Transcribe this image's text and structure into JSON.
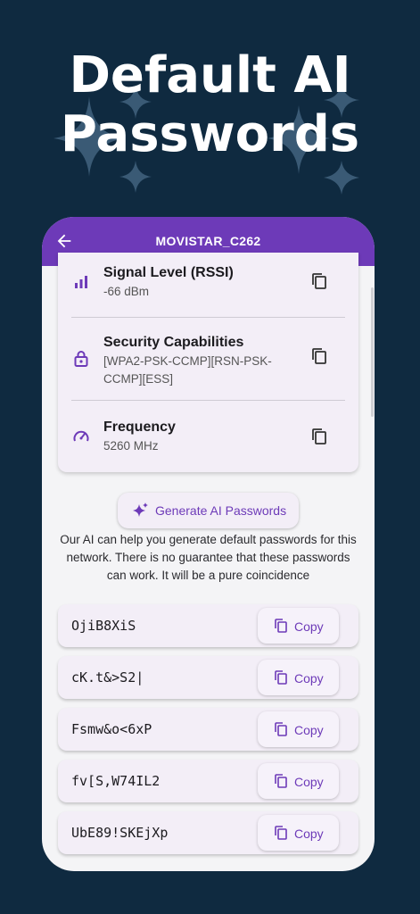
{
  "headline": {
    "line1": "Default AI",
    "line2": "Passwords"
  },
  "colors": {
    "background": "#0f2a40",
    "accent": "#6d3ab8",
    "surface": "#f3eef7",
    "sparkle": "#3a5a75"
  },
  "appbar": {
    "title": "MOVISTAR_C262",
    "back_icon": "arrow-left-icon"
  },
  "network_info": [
    {
      "label": "Signal Level (RSSI)",
      "value": "-66 dBm",
      "icon": "signal-icon"
    },
    {
      "label": "Security Capabilities",
      "value": "[WPA2-PSK-CCMP][RSN-PSK-CCMP][ESS]",
      "icon": "lock-icon"
    },
    {
      "label": "Frequency",
      "value": "5260 MHz",
      "icon": "speedometer-icon"
    }
  ],
  "generate_button": {
    "label": "Generate AI Passwords",
    "icon": "sparkle-icon"
  },
  "disclaimer": "Our AI can help you generate default passwords for this network. There is no guarantee that these passwords can work. It will be a pure coincidence",
  "passwords": [
    {
      "value": "OjiB8XiS",
      "copy_label": "Copy"
    },
    {
      "value": "cK.t&>S2|",
      "copy_label": "Copy"
    },
    {
      "value": "Fsmw&o<6xP",
      "copy_label": "Copy"
    },
    {
      "value": "fv[S,W74IL2",
      "copy_label": "Copy"
    },
    {
      "value": "UbE89!SKEjXp",
      "copy_label": "Copy"
    }
  ]
}
